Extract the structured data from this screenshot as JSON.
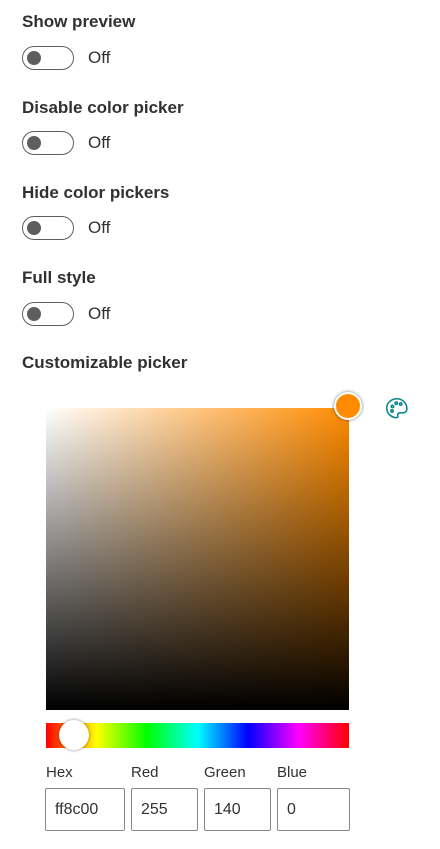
{
  "toggles": [
    {
      "label": "Show preview",
      "state": "Off"
    },
    {
      "label": "Disable color picker",
      "state": "Off"
    },
    {
      "label": "Hide color pickers",
      "state": "Off"
    },
    {
      "label": "Full style",
      "state": "Off"
    }
  ],
  "picker": {
    "title": "Customizable picker",
    "color": "#ff8c00",
    "hue_position": 0.092,
    "fields": {
      "hex": {
        "label": "Hex",
        "value": "ff8c00"
      },
      "red": {
        "label": "Red",
        "value": "255"
      },
      "green": {
        "label": "Green",
        "value": "140"
      },
      "blue": {
        "label": "Blue",
        "value": "0"
      }
    },
    "icons": {
      "palette": "palette-icon"
    }
  },
  "colors": {
    "text": "#323130",
    "toggle_off": "#605e5c",
    "accent": "#ff8c00",
    "icon": "#038387"
  }
}
